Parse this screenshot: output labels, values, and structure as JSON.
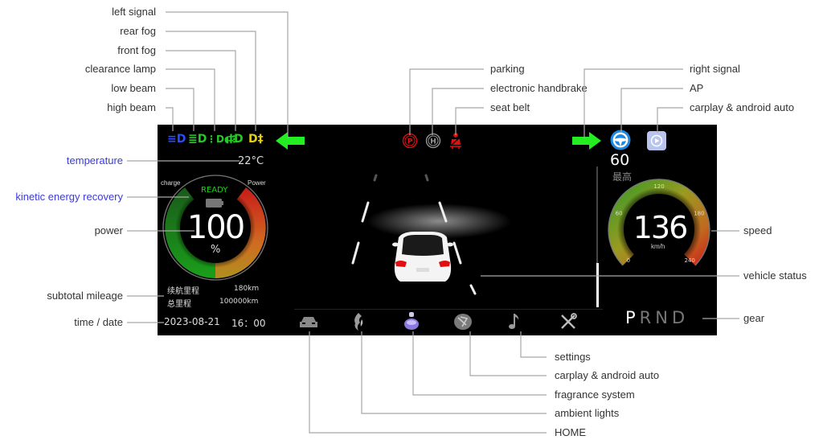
{
  "annotations": {
    "top_left": [
      "left signal",
      "rear fog",
      "front fog",
      "clearance lamp",
      "low beam",
      "high beam"
    ],
    "top_center": [
      "parking",
      "electronic handbrake",
      "seat belt"
    ],
    "top_right": [
      "right signal",
      "AP",
      "carplay & android auto"
    ],
    "left": {
      "temperature": "temperature",
      "kinetic": "kinetic energy recovery",
      "power": "power",
      "mileage": "subtotal mileage",
      "time": "time / date"
    },
    "right": {
      "speed": "speed",
      "vehicle": "vehicle status",
      "gear": "gear"
    },
    "bottom": [
      "settings",
      "carplay & android auto",
      "fragrance system",
      "ambient lights",
      "HOME"
    ]
  },
  "dashboard": {
    "lights": [
      {
        "name": "high-beam-icon",
        "glyph": "≡D",
        "color": "#2b4cff"
      },
      {
        "name": "low-beam-icon",
        "glyph": "≣D",
        "color": "#22cc22"
      },
      {
        "name": "clearance-lamp-icon",
        "glyph": "ᗡ0ᗞ",
        "color": "#22cc22"
      },
      {
        "name": "front-fog-icon",
        "glyph": "‡D",
        "color": "#22cc22"
      },
      {
        "name": "rear-fog-icon",
        "glyph": "D‡",
        "color": "#e8d010"
      }
    ],
    "temperature": "22°C",
    "power_gauge": {
      "charge_label": "charge",
      "power_label": "Power",
      "status": "READY",
      "value": "100",
      "unit": "%",
      "battery_fraction": 1.0
    },
    "mileage": {
      "range_label": "续航里程",
      "range_value": "180km",
      "total_label": "总里程",
      "total_value": "100000km"
    },
    "datetime": {
      "date": "2023-08-21",
      "time": "16：00"
    },
    "warnings": {
      "parking": "P",
      "handbrake": "H"
    },
    "speed_limit": {
      "value": "60",
      "label": "最高"
    },
    "speed_gauge": {
      "value": "136",
      "unit": "km/h",
      "ticks": [
        "0",
        "60",
        "120",
        "180",
        "240"
      ],
      "min": 0,
      "max": 240
    },
    "gear": {
      "letters": [
        "P",
        "R",
        "N",
        "D"
      ],
      "active": "P"
    },
    "colors": {
      "signal": "#22ee22",
      "ap": "#1e88e5",
      "carplay": "#b8c4ee",
      "ready": "#22cc22",
      "warning": "#e01010"
    }
  }
}
